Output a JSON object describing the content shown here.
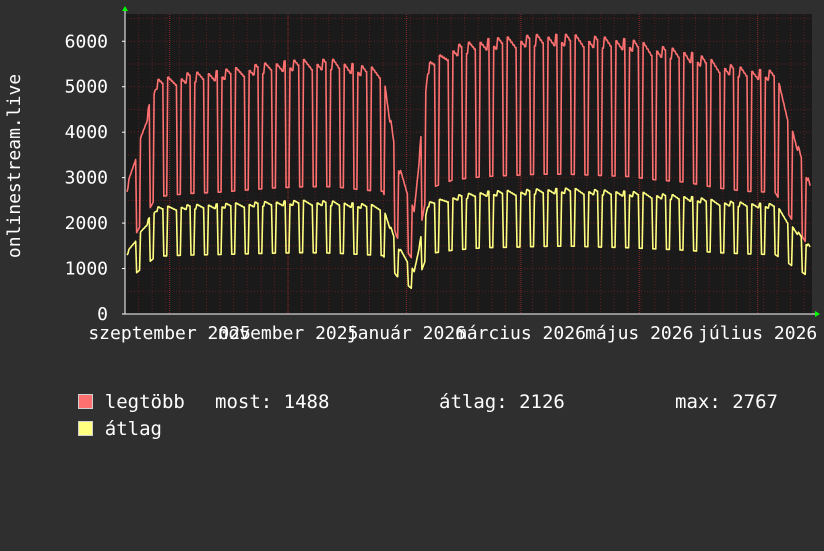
{
  "chart_data": {
    "type": "line",
    "ylabel": "onlinestream.live",
    "ylim": [
      0,
      6600
    ],
    "yticks": [
      0,
      1000,
      2000,
      3000,
      4000,
      5000,
      6000
    ],
    "grid": true,
    "x_ticks": [
      {
        "label": "szeptember 2025",
        "date": "2025-09-01"
      },
      {
        "label": "november 2025",
        "date": "2025-11-01"
      },
      {
        "label": "január 2026",
        "date": "2026-01-01"
      },
      {
        "label": "március 2026",
        "date": "2026-03-01"
      },
      {
        "label": "május 2026",
        "date": "2026-05-01"
      },
      {
        "label": "július 2026",
        "date": "2026-07-01"
      }
    ],
    "x_range": [
      "2025-08-09",
      "2026-07-29"
    ],
    "series": [
      {
        "name": "legtöbb",
        "color": "#ff7070",
        "description": "daily maximum, weekly cycle",
        "points": [
          [
            "2025-08-10",
            2800
          ],
          [
            "2025-08-25",
            5150
          ],
          [
            "2025-09-10",
            5300
          ],
          [
            "2025-09-25",
            5350
          ],
          [
            "2025-10-10",
            5450
          ],
          [
            "2025-10-25",
            5550
          ],
          [
            "2025-11-10",
            5600
          ],
          [
            "2025-11-25",
            5600
          ],
          [
            "2025-12-10",
            5450
          ],
          [
            "2025-12-20",
            5400
          ],
          [
            "2025-12-27",
            3400
          ],
          [
            "2026-01-05",
            2300
          ],
          [
            "2026-01-12",
            5500
          ],
          [
            "2026-01-25",
            5900
          ],
          [
            "2026-02-10",
            6050
          ],
          [
            "2026-02-25",
            6100
          ],
          [
            "2026-03-10",
            6150
          ],
          [
            "2026-03-25",
            6150
          ],
          [
            "2026-04-10",
            6100
          ],
          [
            "2026-04-25",
            6050
          ],
          [
            "2026-05-10",
            5900
          ],
          [
            "2026-05-25",
            5800
          ],
          [
            "2026-06-10",
            5550
          ],
          [
            "2026-06-25",
            5400
          ],
          [
            "2026-07-10",
            5350
          ],
          [
            "2026-07-28",
            2850
          ]
        ]
      },
      {
        "name": "átlag",
        "color": "#ffff80",
        "description": "daily average, weekly cycle",
        "points": [
          [
            "2025-08-10",
            1350
          ],
          [
            "2025-08-25",
            2350
          ],
          [
            "2025-09-10",
            2400
          ],
          [
            "2025-09-25",
            2420
          ],
          [
            "2025-10-10",
            2450
          ],
          [
            "2025-10-25",
            2480
          ],
          [
            "2025-11-10",
            2500
          ],
          [
            "2025-11-25",
            2480
          ],
          [
            "2025-12-10",
            2420
          ],
          [
            "2025-12-20",
            2380
          ],
          [
            "2025-12-27",
            1550
          ],
          [
            "2026-01-05",
            950
          ],
          [
            "2026-01-12",
            2450
          ],
          [
            "2026-01-25",
            2600
          ],
          [
            "2026-02-10",
            2700
          ],
          [
            "2026-02-25",
            2720
          ],
          [
            "2026-03-10",
            2750
          ],
          [
            "2026-03-25",
            2767
          ],
          [
            "2026-04-10",
            2730
          ],
          [
            "2026-04-25",
            2700
          ],
          [
            "2026-05-10",
            2650
          ],
          [
            "2026-05-25",
            2600
          ],
          [
            "2026-06-10",
            2500
          ],
          [
            "2026-06-25",
            2450
          ],
          [
            "2026-07-10",
            2420
          ],
          [
            "2026-07-28",
            1488
          ]
        ]
      }
    ]
  },
  "legend": {
    "items": [
      {
        "label": "legtöbb",
        "color": "#ff7070"
      },
      {
        "label": "átlag",
        "color": "#ffff80"
      }
    ],
    "stats": {
      "most": "most: 1488",
      "atlag": "átlag: 2126",
      "max": "max: 2767"
    }
  },
  "colors": {
    "background": "#2f2f2f",
    "plot_background": "#1a1a1a",
    "grid": "#5a2020",
    "axis": "#ffffff",
    "arrow": "#00ff00"
  }
}
